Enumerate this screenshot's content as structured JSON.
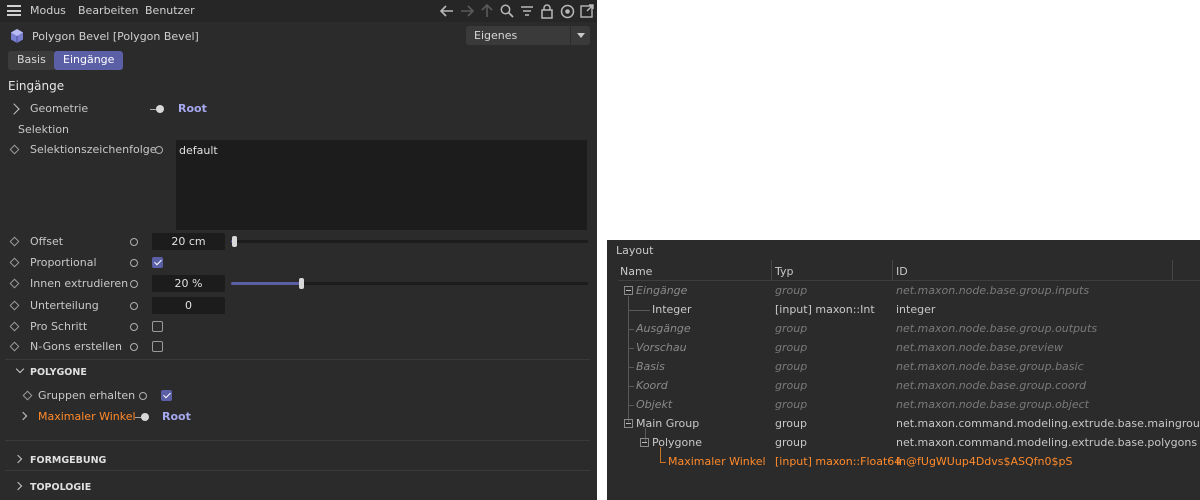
{
  "menubar": {
    "items": [
      "Modus",
      "Bearbeiten",
      "Benutzer"
    ],
    "icons": [
      "back-arrow-icon",
      "forward-arrow-icon",
      "up-arrow-icon",
      "search-icon",
      "filter-icon",
      "lock-icon",
      "target-icon",
      "new-window-icon"
    ]
  },
  "object": {
    "title": "Polygon Bevel [Polygon Bevel]",
    "mode_select": "Eigenes"
  },
  "tabs": {
    "basis": "Basis",
    "eingaenge": "Eingänge"
  },
  "section": {
    "title": "Eingänge"
  },
  "attributes": {
    "geometrie": {
      "label": "Geometrie",
      "link": "Root"
    },
    "selektion": {
      "label": "Selektion"
    },
    "selektionszeichenfolge": {
      "label": "Selektionszeichenfolge",
      "value": "default"
    },
    "offset": {
      "label": "Offset",
      "value": "20 cm",
      "slider_fraction": 0.01
    },
    "proportional": {
      "label": "Proportional",
      "checked": true
    },
    "innen_extrudieren": {
      "label": "Innen extrudieren",
      "value": "20 %",
      "slider_fraction": 0.2
    },
    "unterteilung": {
      "label": "Unterteilung",
      "value": "0"
    },
    "pro_schritt": {
      "label": "Pro Schritt",
      "checked": false
    },
    "n_gons": {
      "label": "N-Gons erstellen",
      "checked": false
    }
  },
  "groups": {
    "polygone": {
      "title": "POLYGONE",
      "gruppen_erhalten": {
        "label": "Gruppen erhalten",
        "checked": true
      },
      "maximaler_winkel": {
        "label": "Maximaler Winkel",
        "link": "Root"
      }
    },
    "formgebung": {
      "title": "FORMGEBUNG"
    },
    "topologie": {
      "title": "TOPOLOGIE"
    }
  },
  "layout_panel": {
    "title": "Layout",
    "columns": [
      "Name",
      "Typ",
      "ID"
    ],
    "rows": [
      {
        "name": "Eingänge",
        "typ": "group",
        "id": "net.maxon.node.base.group.inputs"
      },
      {
        "name": "Integer",
        "typ": "[input] maxon::Int",
        "id": "integer"
      },
      {
        "name": "Ausgänge",
        "typ": "group",
        "id": "net.maxon.node.base.group.outputs"
      },
      {
        "name": "Vorschau",
        "typ": "group",
        "id": "net.maxon.node.base.preview"
      },
      {
        "name": "Basis",
        "typ": "group",
        "id": "net.maxon.node.base.group.basic"
      },
      {
        "name": "Koord",
        "typ": "group",
        "id": "net.maxon.node.base.group.coord"
      },
      {
        "name": "Objekt",
        "typ": "group",
        "id": "net.maxon.node.base.group.object"
      },
      {
        "name": "Main Group",
        "typ": "group",
        "id": "net.maxon.command.modeling.extrude.base.maingroup"
      },
      {
        "name": "Polygone",
        "typ": "group",
        "id": "net.maxon.command.modeling.extrude.base.polygons"
      },
      {
        "name": "Maximaler Winkel",
        "typ": "[input] maxon::Float64",
        "id": "in@fUgWUup4Ddvs$ASQfn0$pS"
      }
    ]
  },
  "colors": {
    "accent": "#5b5fa6",
    "link": "#a7a9f0",
    "highlight": "#ff8a2a",
    "panel_bg": "#2b2b2b"
  }
}
